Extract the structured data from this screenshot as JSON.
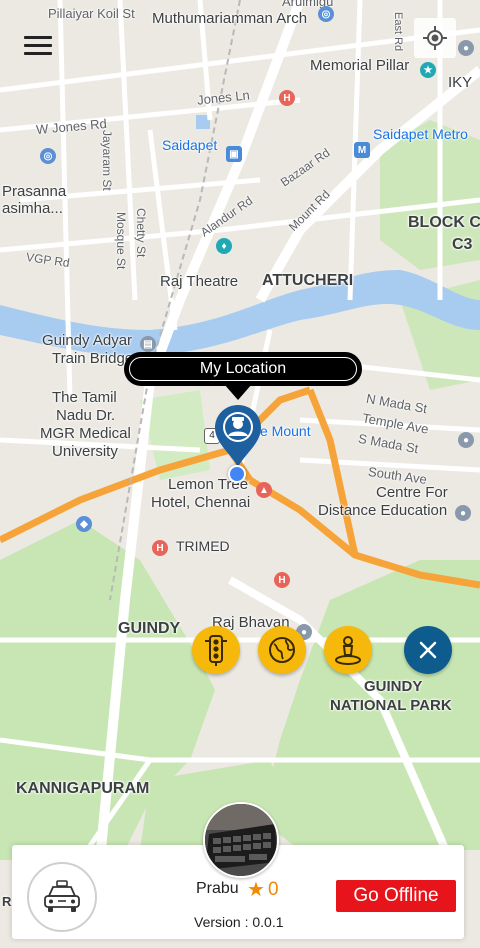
{
  "map": {
    "labels": {
      "pillaiyar_koil": "Pillaiyar Koil St",
      "muthumariamman": "Muthumariamman Arch",
      "arulmigu": "Arulmigu",
      "east_rd": "East Rd",
      "memorial_pillar": "Memorial Pillar",
      "iky": "IKY",
      "jones_ln": "Jones Ln",
      "w_jones_rd": "W Jones Rd",
      "saidapet_metro": "Saidapet Metro",
      "saidapet": "Saidapet",
      "jayaram_st": "Jayaram St",
      "prasanna": "Prasanna",
      "asimha": "asimha...",
      "bazaar_rd": "Bazaar Rd",
      "alandur_rd": "Alandur Rd",
      "mount_rd": "Mount Rd",
      "block": "BLOCK C",
      "c3": "C3",
      "vgp_rd": "VGP Rd",
      "mosque_st": "Mosque St",
      "chetty_st": "Chetty St",
      "raj_theatre": "Raj Theatre",
      "attucheri": "ATTUCHERI",
      "guindy_adyar": "Guindy Adyar",
      "train_bridge": "Train Bridge",
      "tamil_nadu_line1": "The Tamil",
      "tamil_nadu_line2": "Nadu Dr.",
      "tamil_nadu_line3": "MGR Medical",
      "tamil_nadu_line4": "University",
      "n_mada_st": "N Mada St",
      "temple_ave": "Temple Ave",
      "s_mada_st": "S Mada St",
      "the_mount": "e Mount",
      "highway_shield": "4",
      "lemon_tree_1": "Lemon Tree",
      "lemon_tree_2": "Hotel, Chennai",
      "south_ave": "South Ave",
      "centre_for": "Centre For",
      "distance_edu": "Distance Education",
      "trimed": "TRIMED",
      "raj_bhavan": "Raj Bhavan",
      "guindy": "GUINDY",
      "guindy_np_1": "GUINDY",
      "guindy_np_2": "NATIONAL PARK",
      "kannigapuram": "KANNIGAPURAM",
      "ra": "RA"
    }
  },
  "header": {
    "menu_icon": "hamburger-menu-icon",
    "locate_icon": "crosshair-locate-icon"
  },
  "location_callout": {
    "label": "My Location"
  },
  "fabs": [
    {
      "icon": "traffic-light-icon"
    },
    {
      "icon": "globe-icon"
    },
    {
      "icon": "map-pin-person-icon"
    },
    {
      "icon": "close-icon"
    }
  ],
  "driver": {
    "name": "Prabu",
    "rating": "0",
    "version": "Version : 0.0.1",
    "status_button": "Go Offline"
  },
  "colors": {
    "accent_yellow": "#f6b80a",
    "close_blue": "#0e5c8e",
    "offline_red": "#e8141b",
    "rating_orange": "#f08a00",
    "pin_blue": "#1e5fa0"
  }
}
